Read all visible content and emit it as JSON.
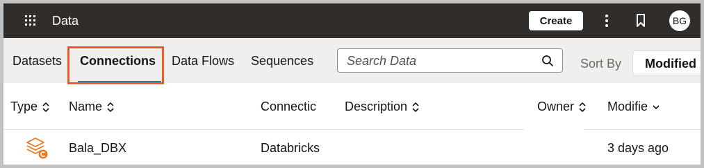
{
  "topbar": {
    "app_title": "Data",
    "create_label": "Create",
    "avatar_initials": "BG",
    "background": "#312d2a"
  },
  "tabs": [
    {
      "label": "Datasets",
      "active": false
    },
    {
      "label": "Connections",
      "active": true
    },
    {
      "label": "Data Flows",
      "active": false
    },
    {
      "label": "Sequences",
      "active": false
    }
  ],
  "search": {
    "placeholder": "Search Data"
  },
  "sort": {
    "label": "Sort By",
    "value": "Modified"
  },
  "table": {
    "columns": [
      "Type",
      "Name",
      "Connectic",
      "Description",
      "Owner",
      "Modifie"
    ],
    "rows": [
      {
        "type_icon": "databricks-connection-icon",
        "name": "Bala_DBX",
        "connection": "Databricks",
        "description": "",
        "owner": "",
        "modified": "3 days ago"
      }
    ]
  },
  "colors": {
    "accent": "#227e9e",
    "highlight": "#f0591f",
    "icon": "#e87722"
  }
}
